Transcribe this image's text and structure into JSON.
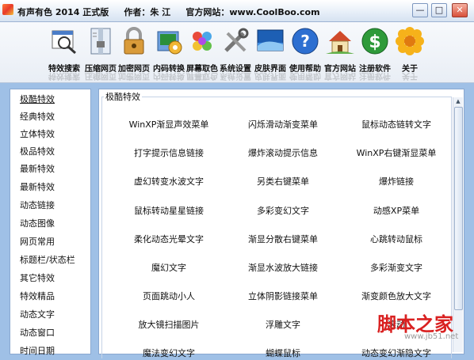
{
  "window": {
    "title": "有声有色 2014 正式版     作者：朱 江     官方网站：www.CoolBoo.com",
    "minimize": "—",
    "maximize": "□",
    "close": "✕"
  },
  "toolbar": [
    {
      "label": "特效搜索",
      "icon": "search-icon"
    },
    {
      "label": "压缩网页",
      "icon": "zip-icon"
    },
    {
      "label": "加密网页",
      "icon": "lock-icon"
    },
    {
      "label": "内码转换",
      "icon": "convert-icon"
    },
    {
      "label": "屏幕取色",
      "icon": "palette-icon"
    },
    {
      "label": "系统设置",
      "icon": "tools-icon"
    },
    {
      "label": "皮肤界面",
      "icon": "skin-icon"
    },
    {
      "label": "使用帮助",
      "icon": "help-icon"
    },
    {
      "label": "官方网站",
      "icon": "home-icon"
    },
    {
      "label": "注册软件",
      "icon": "dollar-icon"
    },
    {
      "label": "关于",
      "icon": "flower-icon"
    }
  ],
  "sidebar": {
    "items": [
      "极酷特效",
      "经典特效",
      "立体特效",
      "极品特效",
      "最新特效",
      "最新特效",
      "动态链接",
      "动态图像",
      "网页常用",
      "标题栏/状态栏",
      "其它特效",
      "特效精品",
      "动态文字",
      "动态窗口",
      "时间日期"
    ],
    "active_index": 0
  },
  "panel": {
    "title": "极酷特效",
    "effects": [
      [
        "WinXP渐显声效菜单",
        "闪烁滑动渐变菜单",
        "鼠标动态链转文字"
      ],
      [
        "打字提示信息链接",
        "爆炸滚动提示信息",
        "WinXP右键渐显菜单"
      ],
      [
        "虚幻转变水波文字",
        "另类右键菜单",
        "爆炸链接"
      ],
      [
        "鼠标转动星星链接",
        "多彩变幻文字",
        "动感XP菜单"
      ],
      [
        "柔化动态光晕文字",
        "渐显分散右键菜单",
        "心跳转动鼠标"
      ],
      [
        "魔幻文字",
        "渐显水波放大链接",
        "多彩渐变文字"
      ],
      [
        "页面跳动小人",
        "立体阴影链接菜单",
        "渐变颜色放大文字"
      ],
      [
        "放大镜扫描图片",
        "浮雕文字",
        "滚动"
      ],
      [
        "魔法变幻文字",
        "蝴蝶鼠标",
        "动态变幻渐隐文字"
      ]
    ]
  },
  "watermark": {
    "text": "脚本之家",
    "url": "www.jb51.net"
  },
  "colors": {
    "background": "#9fc0e6",
    "border": "#8aa8d0",
    "watermark": "#d92020"
  }
}
